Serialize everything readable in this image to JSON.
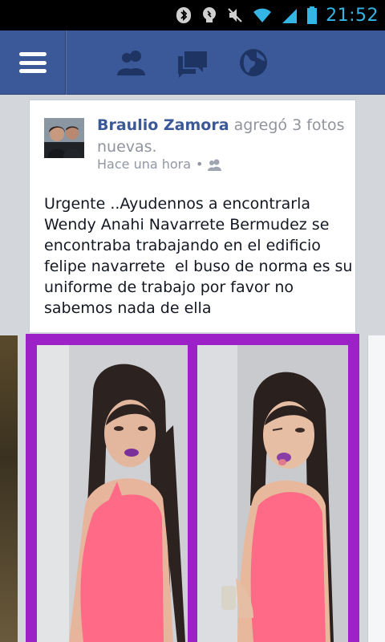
{
  "status_bar": {
    "time": "21:52",
    "icons": [
      "bluetooth-icon",
      "lightbulb-icon",
      "mute-icon",
      "wifi-icon",
      "signal-icon",
      "battery-icon"
    ],
    "accent_color": "#33b5e5"
  },
  "header": {
    "bg_color": "#3b5998",
    "icons": [
      "menu-icon",
      "friend-requests-icon",
      "messages-icon",
      "notifications-globe-icon"
    ]
  },
  "post": {
    "author": "Braulio Zamora",
    "action": " agregó 3 fotos nuevas.",
    "timestamp": "Hace una hora",
    "audience_separator": "•",
    "audience_icon": "friends-icon",
    "text": "Urgente ..Ayudennos a encontrarla\nWendy Anahi Navarrete Bermudez se\nencontraba trabajando en el edificio\nfelipe navarrete  el buso de norma es su\nuniforme de trabajo por favor no\nsabemos nada de ella",
    "photo_frame_color": "#9c22c8"
  }
}
